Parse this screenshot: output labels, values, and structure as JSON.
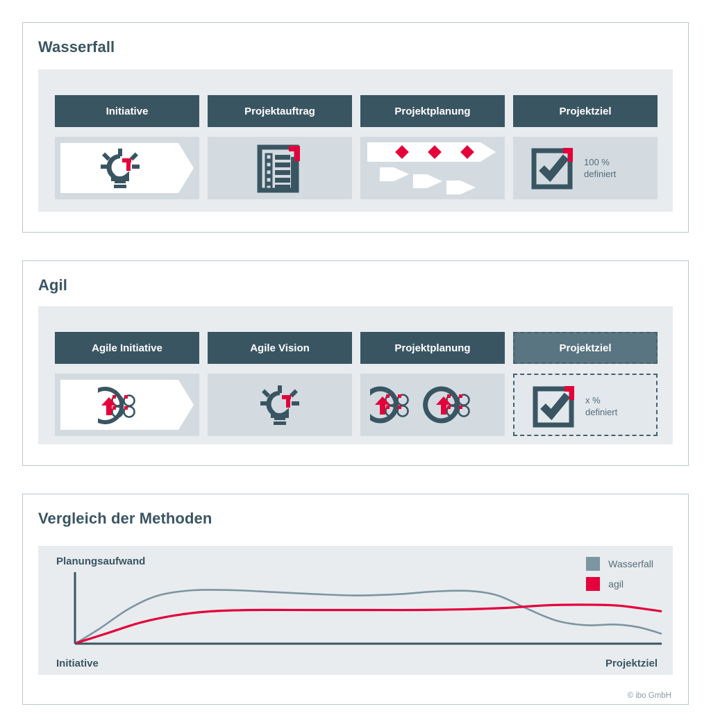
{
  "colors": {
    "dark_slate": "#3a5562",
    "muted_slate": "#5a7582",
    "band_bg": "#e8ecef",
    "cell_bg": "#d3dbe1",
    "white": "#ffffff",
    "red": "#e4003a",
    "legend_gray": "#7d94a1",
    "panel_border": "#b9c6cf",
    "text_gray": "#556b78"
  },
  "panels": [
    {
      "id": "waterfall",
      "title": "Wasserfall",
      "steps": [
        {
          "label": "Initiative",
          "icon": "lightbulb-idea-icon",
          "note": ""
        },
        {
          "label": "Projektauftrag",
          "icon": "checklist-document-icon",
          "note": ""
        },
        {
          "label": "Projektplanung",
          "icon": "gantt-milestones-icon",
          "note": ""
        },
        {
          "label": "Projektziel",
          "icon": "checkbox-checked-icon",
          "note": "100 %\ndefiniert",
          "note_line1": "100 %",
          "note_line2": "definiert"
        }
      ]
    },
    {
      "id": "agile",
      "title": "Agil",
      "steps": [
        {
          "label": "Agile Initiative",
          "icon": "sprint-cycle-icon",
          "note": ""
        },
        {
          "label": "Agile Vision",
          "icon": "lightbulb-idea-icon",
          "note": ""
        },
        {
          "label": "Projektplanung",
          "icon": "double-sprint-cycle-icon",
          "note": ""
        },
        {
          "label": "Projektziel",
          "icon": "checkbox-checked-icon",
          "note": "x %\ndefiniert",
          "note_line1": "x %",
          "note_line2": "definiert",
          "dashed": true
        }
      ]
    }
  ],
  "compare": {
    "title": "Vergleich der Methoden",
    "copyright": "© ibo GmbH"
  },
  "chart_data": {
    "type": "line",
    "title": "Vergleich der Methoden",
    "ylabel": "Planungsaufwand",
    "xlabel": "",
    "x_tick_labels": [
      "Initiative",
      "Projektziel"
    ],
    "xlim": [
      0,
      100
    ],
    "ylim": [
      0,
      100
    ],
    "grid": false,
    "legend_position": "top-right",
    "axis_ticks_shown": false,
    "series": [
      {
        "name": "Wasserfall",
        "color": "#7d94a1",
        "x": [
          0,
          4,
          9,
          14,
          20,
          27,
          34,
          41,
          48,
          55,
          61,
          67,
          72,
          77,
          82,
          87,
          92,
          96,
          100
        ],
        "y": [
          0,
          22,
          52,
          72,
          80,
          80,
          77,
          74,
          72,
          74,
          78,
          79,
          72,
          52,
          34,
          27,
          28,
          24,
          14
        ]
      },
      {
        "name": "agil",
        "color": "#e4003a",
        "x": [
          0,
          5,
          11,
          17,
          23,
          30,
          40,
          50,
          58,
          66,
          73,
          80,
          86,
          92,
          96,
          100
        ],
        "y": [
          0,
          14,
          31,
          42,
          48,
          50,
          50,
          50,
          50,
          51,
          53,
          57,
          58,
          57,
          53,
          48
        ]
      }
    ]
  }
}
